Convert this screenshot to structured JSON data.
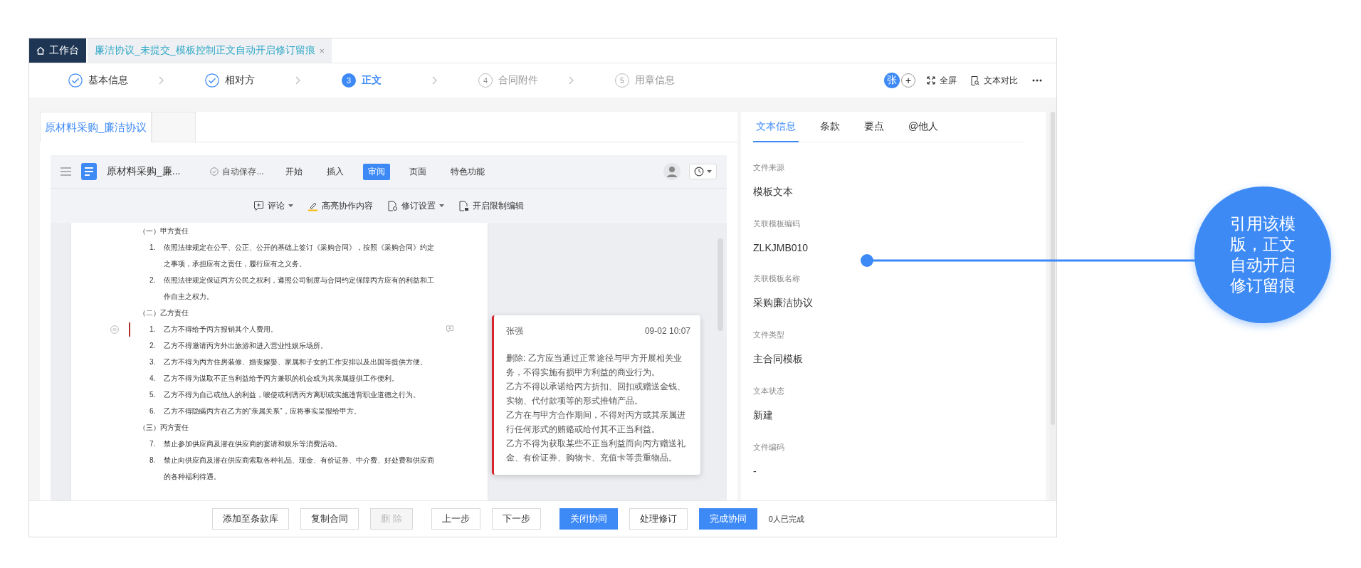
{
  "header_tabs": [
    {
      "kind": "home",
      "label": "工作台",
      "selected": false
    },
    {
      "kind": "doc",
      "label": "廉洁协议_未提交_模板控制正文自动开启修订留痕",
      "selected": true,
      "close": "×"
    }
  ],
  "steps": [
    {
      "done": true,
      "selected": false,
      "label": "基本信息"
    },
    {
      "done": true,
      "selected": false,
      "label": "相对方"
    },
    {
      "done": false,
      "selected": true,
      "number": "3",
      "label": "正文"
    },
    {
      "done": false,
      "selected": false,
      "number": "4",
      "label": "合同附件"
    },
    {
      "done": false,
      "selected": false,
      "number": "5",
      "label": "用章信息"
    }
  ],
  "header_actions": {
    "avatar": "张",
    "add": "+",
    "fullscreen": "全屏",
    "compare": "文本对比"
  },
  "doc_tabs": [
    {
      "label": "原材料采购_廉洁协议",
      "selected": true
    }
  ],
  "editor": {
    "title": "原材料采购_廉...",
    "save_status": "自动保存...",
    "menu": [
      {
        "label": "开始",
        "selected": false
      },
      {
        "label": "插入",
        "selected": false
      },
      {
        "label": "审阅",
        "selected": true
      },
      {
        "label": "页面",
        "selected": false
      },
      {
        "label": "特色功能",
        "selected": false
      }
    ],
    "tools": [
      {
        "kind": "comment",
        "label": "评论",
        "dropdown": true
      },
      {
        "kind": "highlight",
        "label": "高亮协作内容",
        "dropdown": false
      },
      {
        "kind": "revision",
        "label": "修订设置",
        "dropdown": true
      },
      {
        "kind": "restrict",
        "label": "开启限制编辑",
        "dropdown": false
      }
    ]
  },
  "document": [
    {
      "kind": "heading",
      "text": "（一）甲方责任"
    },
    {
      "kind": "item",
      "number": "1.",
      "text": "依照法律规定在公平、公正、公开的基础上签订《采购合同》，按照《采购合同》约定之事项，承担应有之责任，履行应有之义务。",
      "revised": false
    },
    {
      "kind": "item",
      "number": "2.",
      "text": "依照法律规定保证丙方公民之权利，遵照公司制度与合同约定保障丙方应有的利益和工作自主之权力。",
      "revised": false
    },
    {
      "kind": "heading",
      "text": "（二）乙方责任"
    },
    {
      "kind": "item",
      "number": "1.",
      "text": "乙方不得给予丙方报销其个人费用。",
      "revised": true
    },
    {
      "kind": "item",
      "number": "2.",
      "text": "乙方不得邀请丙方外出旅游和进入营业性娱乐场所。",
      "revised": false
    },
    {
      "kind": "item",
      "number": "3.",
      "text": "乙方不得为丙方住房装修、婚丧嫁娶、家属和子女的工作安排以及出国等提供方便。",
      "revised": false
    },
    {
      "kind": "item",
      "number": "4.",
      "text": "乙方不得为谋取不正当利益给予丙方兼职的机会或为其亲属提供工作便利。",
      "revised": false
    },
    {
      "kind": "item",
      "number": "5.",
      "text": "乙方不得为自己或他人的利益，唆使或利诱丙方离职或实施违背职业道德之行为。",
      "revised": false
    },
    {
      "kind": "item",
      "number": "6.",
      "text": "乙方不得隐瞒丙方在乙方的“亲属关系”，应将事实呈报给甲方。",
      "revised": false
    },
    {
      "kind": "heading",
      "text": "（三）丙方责任"
    },
    {
      "kind": "item",
      "number": "7.",
      "text": "禁止参加供应商及潜在供应商的宴请和娱乐等消费活动。",
      "revised": false
    },
    {
      "kind": "item",
      "number": "8.",
      "text": "禁止向供应商及潜在供应商索取各种礼品、现金、有价证券、中介费、好处费和供应商的各种福利待遇。",
      "revised": false
    }
  ],
  "comment": {
    "author": "张强",
    "time": "09-02 10:07",
    "paragraphs": [
      "删除: 乙方应当通过正常途径与甲方开展相关业务，不得实施有损甲方利益的商业行为。",
      "乙方不得以承诺给丙方折扣、回扣或赠送金钱、实物、代付款项等的形式推销产品。",
      "乙方在与甲方合作期间，不得对丙方或其亲属进行任何形式的贿赂或给付其不正当利益。",
      "乙方不得为获取某些不正当利益而向丙方赠送礼金、有价证券、购物卡、充值卡等贵重物品。"
    ]
  },
  "info_tabs": [
    {
      "label": "文本信息",
      "selected": true
    },
    {
      "label": "条款",
      "selected": false
    },
    {
      "label": "要点",
      "selected": false
    },
    {
      "label": "@他人",
      "selected": false
    }
  ],
  "info_fields": [
    {
      "label": "文件来源",
      "value": "模板文本"
    },
    {
      "label": "关联模板编码",
      "value": "ZLKJMB010"
    },
    {
      "label": "关联模板名称",
      "value": "采购廉洁协议"
    },
    {
      "label": "文件类型",
      "value": "主合同模板"
    },
    {
      "label": "文本状态",
      "value": "新建"
    },
    {
      "label": "文件编码",
      "value": "-"
    }
  ],
  "footer_buttons": [
    {
      "label": "添加至条款库",
      "kind": "default",
      "disabled": false
    },
    {
      "label": "复制合同",
      "kind": "default",
      "disabled": false
    },
    {
      "label": "删 除",
      "kind": "default",
      "disabled": true
    },
    {
      "label": "上一步",
      "kind": "default",
      "disabled": false
    },
    {
      "label": "下一步",
      "kind": "default",
      "disabled": false
    },
    {
      "label": "关闭协同",
      "kind": "primary",
      "disabled": false
    },
    {
      "label": "处理修订",
      "kind": "default",
      "disabled": false
    },
    {
      "label": "完成协同",
      "kind": "primary",
      "disabled": false
    }
  ],
  "footer_status": "0人已完成",
  "callout": {
    "text": "引用该模版，正文自动开启修订留痕"
  }
}
